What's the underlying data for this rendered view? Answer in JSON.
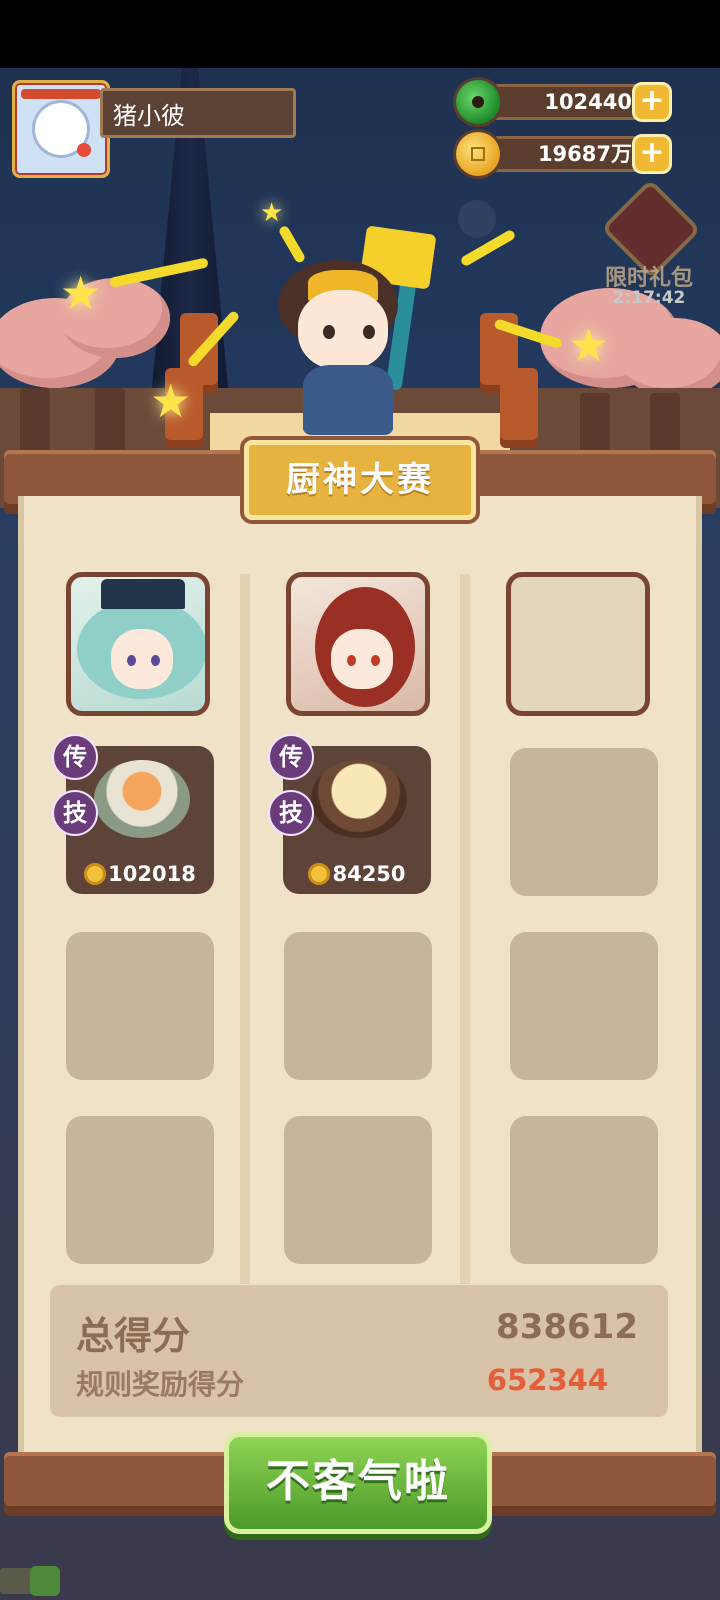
{
  "player": {
    "name": "猪小彼"
  },
  "resources": {
    "jade": "102440",
    "coins": "19687万"
  },
  "gift": {
    "label": "限时礼包",
    "timer": "2:17:42"
  },
  "contest": {
    "title": "厨神大赛"
  },
  "columns": [
    {
      "skill_badges": [
        "传",
        "技"
      ],
      "dish_price": "102018"
    },
    {
      "skill_badges": [
        "传",
        "技"
      ],
      "dish_price": "84250"
    },
    {
      "skill_badges": [],
      "dish_price": ""
    }
  ],
  "score": {
    "total_label": "总得分",
    "total_value": "838612",
    "bonus_label": "规则奖励得分",
    "bonus_value": "652344"
  },
  "confirm_button": "不客气啦",
  "icons": {
    "add": "+",
    "jade": "jade-icon",
    "coin": "coin-icon"
  },
  "colors": {
    "accent_green": "#4c9a2a",
    "gold": "#e6b340",
    "bonus_red": "#e45e3a"
  }
}
